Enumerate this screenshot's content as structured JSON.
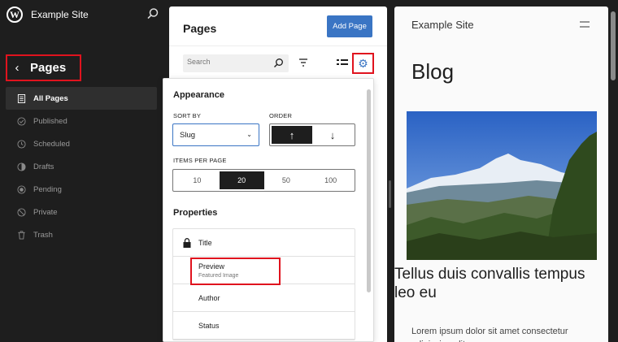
{
  "sidebar": {
    "logo_letter": "W",
    "site_title": "Example Site",
    "back_title": "Pages",
    "items": [
      {
        "label": "All Pages",
        "icon": "pages-icon",
        "active": true
      },
      {
        "label": "Published",
        "icon": "published-icon"
      },
      {
        "label": "Scheduled",
        "icon": "scheduled-icon"
      },
      {
        "label": "Drafts",
        "icon": "drafts-icon"
      },
      {
        "label": "Pending",
        "icon": "pending-icon"
      },
      {
        "label": "Private",
        "icon": "private-icon"
      },
      {
        "label": "Trash",
        "icon": "trash-icon"
      }
    ]
  },
  "pages": {
    "title": "Pages",
    "add_label": "Add Page",
    "search_placeholder": "Search"
  },
  "view_options": {
    "appearance_title": "Appearance",
    "sort_by_label": "SORT BY",
    "sort_by_value": "Slug",
    "order_label": "ORDER",
    "order_options": [
      "↑",
      "↓"
    ],
    "order_selected": 0,
    "items_per_page_label": "ITEMS PER PAGE",
    "items_per_page_options": [
      "10",
      "20",
      "50",
      "100"
    ],
    "items_per_page_selected": 1,
    "properties_title": "Properties",
    "properties": [
      {
        "label": "Title",
        "sub": "",
        "locked": true
      },
      {
        "label": "Preview",
        "sub": "Featured Image"
      },
      {
        "label": "Author",
        "sub": ""
      },
      {
        "label": "Status",
        "sub": ""
      }
    ]
  },
  "preview": {
    "site_title": "Example Site",
    "heading": "Blog",
    "post_title": "Tellus duis convallis tempus leo eu",
    "excerpt": "Lorem ipsum dolor sit amet consectetur adipiscing elit"
  },
  "colors": {
    "accent": "#3a75c4",
    "highlight": "#e0131e",
    "sidebar_bg": "#1e1e1e"
  }
}
